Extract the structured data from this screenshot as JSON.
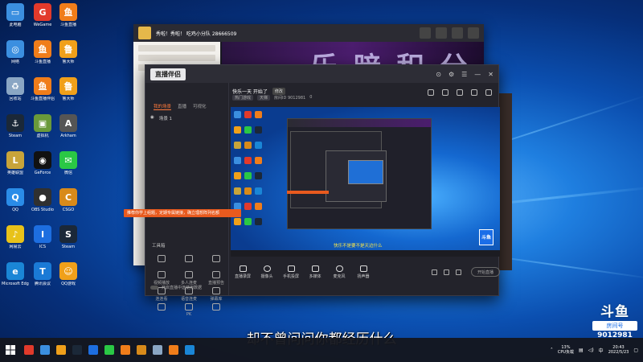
{
  "desktop": {
    "icons": [
      {
        "label": "此电脑",
        "color": "#3b8fe0",
        "glyph": "▭"
      },
      {
        "label": "WeGame",
        "color": "#e23a2b",
        "glyph": "G"
      },
      {
        "label": "斗鱼直播",
        "color": "#f07d1a",
        "glyph": "鱼"
      },
      {
        "label": "网络",
        "color": "#3b8fe0",
        "glyph": "◎"
      },
      {
        "label": "斗鱼直播",
        "color": "#f07d1a",
        "glyph": "鱼"
      },
      {
        "label": "鲁大师",
        "color": "#f0a01a",
        "glyph": "鲁"
      },
      {
        "label": "回收站",
        "color": "#8aa6c4",
        "glyph": "♻"
      },
      {
        "label": "斗鱼直播伴侣",
        "color": "#f07d1a",
        "glyph": "鱼"
      },
      {
        "label": "鲁大师",
        "color": "#f0a01a",
        "glyph": "鲁"
      },
      {
        "label": "Steam",
        "color": "#1b2838",
        "glyph": "⚓"
      },
      {
        "label": "虚拟机",
        "color": "#6a9a3a",
        "glyph": "▣"
      },
      {
        "label": "Arkham",
        "color": "#555555",
        "glyph": "A"
      },
      {
        "label": "英雄联盟",
        "color": "#c8a43a",
        "glyph": "L"
      },
      {
        "label": "GeForce",
        "color": "#111111",
        "glyph": "◉"
      },
      {
        "label": "微信",
        "color": "#2ac845",
        "glyph": "✉"
      },
      {
        "label": "QQ",
        "color": "#2a8ce8",
        "glyph": "Q"
      },
      {
        "label": "OBS Studio",
        "color": "#303030",
        "glyph": "●"
      },
      {
        "label": "CSGO",
        "color": "#d88a1a",
        "glyph": "C"
      },
      {
        "label": "网易云",
        "color": "#e8c21a",
        "glyph": "♪"
      },
      {
        "label": "ICS",
        "color": "#1d6ee0",
        "glyph": "I"
      },
      {
        "label": "Steam",
        "color": "#1b2838",
        "glyph": "S"
      },
      {
        "label": "Microsoft Edge",
        "color": "#1a86d6",
        "glyph": "e"
      },
      {
        "label": "腾讯会议",
        "color": "#1a7ad6",
        "glyph": "T"
      },
      {
        "label": "QQ游戏",
        "color": "#f0a01a",
        "glyph": "☺"
      }
    ]
  },
  "back_window": {
    "title": "秀啦！秀啦！ 吃鸡小分队  28666509",
    "stage_text": "乐 暗 积 分 赛"
  },
  "main_window": {
    "logo": "直播伴侣",
    "title_controls": [
      "⊙",
      "⚙",
      "☰",
      "—",
      "✕"
    ],
    "tabs": [
      "我的场景",
      "直播",
      "可视化"
    ],
    "scene_label": "场景 1",
    "stream_title": "快乐一天 开始了",
    "tag": "修改",
    "sub_items": [
      "热门游戏",
      "天梯",
      "房间ID 9012981",
      "0"
    ],
    "tools_label": "工具箱",
    "tools": [
      "",
      "",
      "",
      "视频播放",
      "多人连麦",
      "直播预告",
      "连连看",
      "语音连麦",
      "弹幕库",
      "",
      "PK",
      ""
    ],
    "preview_caption": "快乐不是要不是天边什么",
    "brand_badge": "斗鱼",
    "toolbar": [
      "直播录屏",
      "摄像头",
      "手机投屏",
      "多媒体",
      "麦克风",
      "扬声器"
    ],
    "live_button": "开始直播",
    "footer": "开启直播中途使用数据"
  },
  "tip_banner": "推荐你学上组题，定期专属链接，确立理想阵列名额",
  "subtitle": "却不曾问问你都经历什么",
  "watermark": {
    "logo": "斗鱼",
    "badge": "房间号",
    "room": "9012981"
  },
  "taskbar": {
    "apps": [
      "#e23a2b",
      "#3b8fe0",
      "#f0a01a",
      "#1b2838",
      "#1d6ee0",
      "#2ac845",
      "#f07d1a",
      "#d88a1a",
      "#8aa6c4",
      "#f07d1a",
      "#1a86d6"
    ],
    "cpu_percent": "13%",
    "cpu_label": "CPU负载",
    "time": "20:43",
    "date": "2022/5/23"
  }
}
